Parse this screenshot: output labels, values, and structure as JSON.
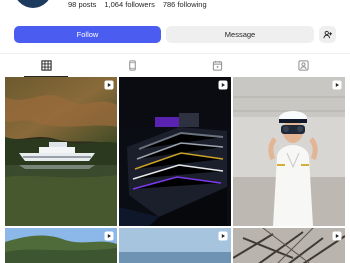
{
  "profile": {
    "stats": [
      {
        "count": "98",
        "label": "posts"
      },
      {
        "count": "1,064",
        "label": "followers"
      },
      {
        "count": "786",
        "label": "following"
      }
    ]
  },
  "actions": {
    "follow_label": "Follow",
    "message_label": "Message",
    "suggest_label": "+"
  },
  "tabs": [
    {
      "name": "posts",
      "icon": "grid-icon",
      "active": true
    },
    {
      "name": "reels",
      "icon": "reels-icon",
      "active": false
    },
    {
      "name": "saved",
      "icon": "calendar-icon",
      "active": false
    },
    {
      "name": "tagged",
      "icon": "tagged-user-icon",
      "active": false
    }
  ],
  "posts": [
    {
      "scene": "yacht-in-fjord",
      "type": "reel"
    },
    {
      "scene": "cruise-ship-night",
      "type": "reel"
    },
    {
      "scene": "captain-with-binoculars",
      "type": "reel"
    },
    {
      "scene": "forested-hill-sky",
      "type": "reel"
    },
    {
      "scene": "sea-horizon",
      "type": "reel"
    },
    {
      "scene": "tree-branches",
      "type": "reel"
    }
  ],
  "colors": {
    "accent": "#4a5df0",
    "button_gray": "#efefef",
    "text": "#262626"
  }
}
